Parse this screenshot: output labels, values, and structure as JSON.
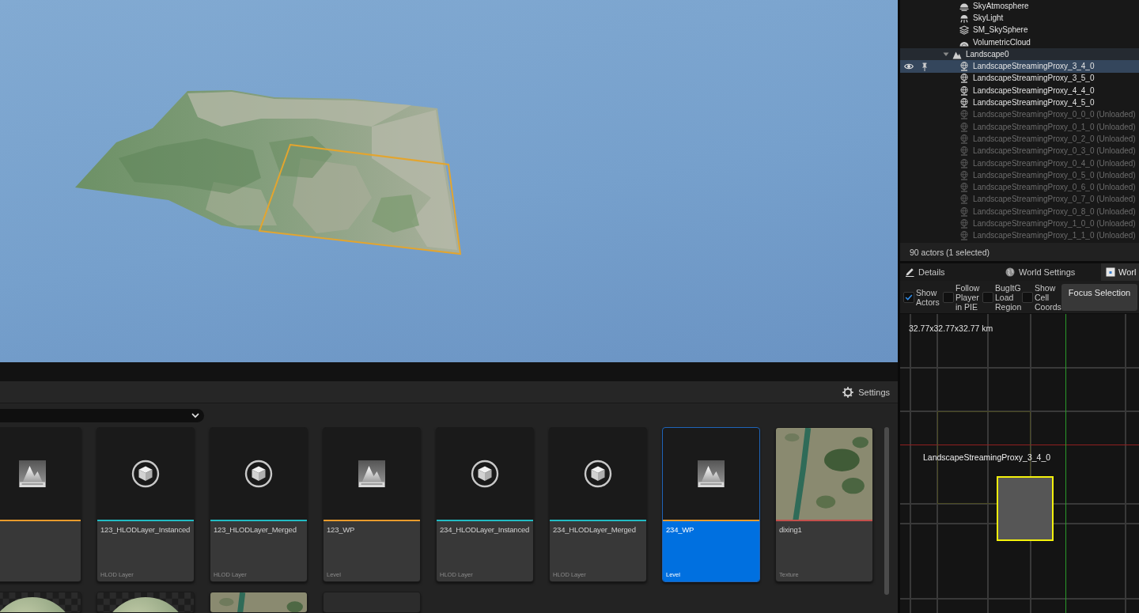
{
  "content_browser": {
    "settings": "Settings",
    "assets": [
      {
        "kind": "level",
        "color": "#e89b2c",
        "selected": false
      },
      {
        "kind": "hlod",
        "color": "#22bcc4",
        "name": "123_HLODLayer_Instanced",
        "type": "HLOD Layer",
        "selected": false
      },
      {
        "kind": "hlod",
        "color": "#22bcc4",
        "name": "123_HLODLayer_Merged",
        "type": "HLOD Layer",
        "selected": false
      },
      {
        "kind": "level",
        "color": "#e89b2c",
        "name": "123_WP",
        "type": "Level",
        "selected": false
      },
      {
        "kind": "hlod",
        "color": "#22bcc4",
        "name": "234_HLODLayer_Instanced",
        "type": "HLOD Layer",
        "selected": false
      },
      {
        "kind": "hlod",
        "color": "#22bcc4",
        "name": "234_HLODLayer_Merged",
        "type": "HLOD Layer",
        "selected": false
      },
      {
        "kind": "level",
        "color": "#e89b2c",
        "name": "234_WP",
        "type": "Level",
        "selected": true
      },
      {
        "kind": "texture",
        "color": "#c4504c",
        "name": "dixing1",
        "type": "Texture",
        "selected": false
      },
      {
        "kind": "material",
        "selected": false
      },
      {
        "kind": "material",
        "selected": false
      },
      {
        "kind": "texture",
        "selected": false
      },
      {
        "kind": "blank",
        "selected": false
      }
    ]
  },
  "outliner": {
    "items": [
      {
        "children": [
          {
            "label": "SkyAtmosphere",
            "kind": "atmosphere",
            "selected": false
          },
          {
            "label": "SkyLight",
            "kind": "light",
            "selected": false
          },
          {
            "label": "SM_SkySphere",
            "kind": "mesh",
            "selected": false
          },
          {
            "label": "VolumetricCloud",
            "kind": "cloud",
            "selected": false
          }
        ]
      },
      {
        "label": "Landscape0",
        "kind": "landscape",
        "expanded": true,
        "selected": false,
        "children": [
          {
            "label": "LandscapeStreamingProxy_3_4_0",
            "kind": "proxy",
            "loaded": true,
            "selected": true
          },
          {
            "label": "LandscapeStreamingProxy_3_5_0",
            "kind": "proxy",
            "loaded": true,
            "selected": false
          },
          {
            "label": "LandscapeStreamingProxy_4_4_0",
            "kind": "proxy",
            "loaded": true,
            "selected": false
          },
          {
            "label": "LandscapeStreamingProxy_4_5_0",
            "kind": "proxy",
            "loaded": true,
            "selected": false
          },
          {
            "label": "LandscapeStreamingProxy_0_0_0 (Unloaded)",
            "kind": "proxy",
            "loaded": false,
            "selected": false
          },
          {
            "label": "LandscapeStreamingProxy_0_1_0 (Unloaded)",
            "kind": "proxy",
            "loaded": false,
            "selected": false
          },
          {
            "label": "LandscapeStreamingProxy_0_2_0 (Unloaded)",
            "kind": "proxy",
            "loaded": false,
            "selected": false
          },
          {
            "label": "LandscapeStreamingProxy_0_3_0 (Unloaded)",
            "kind": "proxy",
            "loaded": false,
            "selected": false
          },
          {
            "label": "LandscapeStreamingProxy_0_4_0 (Unloaded)",
            "kind": "proxy",
            "loaded": false,
            "selected": false
          },
          {
            "label": "LandscapeStreamingProxy_0_5_0 (Unloaded)",
            "kind": "proxy",
            "loaded": false,
            "selected": false
          },
          {
            "label": "LandscapeStreamingProxy_0_6_0 (Unloaded)",
            "kind": "proxy",
            "loaded": false,
            "selected": false
          },
          {
            "label": "LandscapeStreamingProxy_0_7_0 (Unloaded)",
            "kind": "proxy",
            "loaded": false,
            "selected": false
          },
          {
            "label": "LandscapeStreamingProxy_0_8_0 (Unloaded)",
            "kind": "proxy",
            "loaded": false,
            "selected": false
          },
          {
            "label": "LandscapeStreamingProxy_1_0_0 (Unloaded)",
            "kind": "proxy",
            "loaded": false,
            "selected": false
          },
          {
            "label": "LandscapeStreamingProxy_1_1_0 (Unloaded)",
            "kind": "proxy",
            "loaded": false,
            "selected": false
          }
        ]
      }
    ],
    "status": "90 actors (1 selected)"
  },
  "details_tabs": [
    {
      "label": "Details",
      "kind": "details",
      "selected": false
    },
    {
      "label": "World Settings",
      "kind": "world_settings",
      "selected": false
    },
    {
      "label": "Worl",
      "kind": "world_partition",
      "selected": true
    }
  ],
  "world_partition": {
    "toolbar": [
      {
        "kind": "checkbox",
        "label": "Show Actors",
        "checked": true
      },
      {
        "kind": "checkbox",
        "label": "Follow Player in PIE",
        "checked": false
      },
      {
        "kind": "checkbox",
        "label": "BugItG Load Region",
        "checked": false
      },
      {
        "kind": "checkbox",
        "label": "Show Cell Coords",
        "checked": false
      },
      {
        "kind": "button",
        "label": "Focus Selection"
      }
    ],
    "scale": "32.77x32.77x32.77 km",
    "actor_label": "LandscapeStreamingProxy_3_4_0"
  }
}
